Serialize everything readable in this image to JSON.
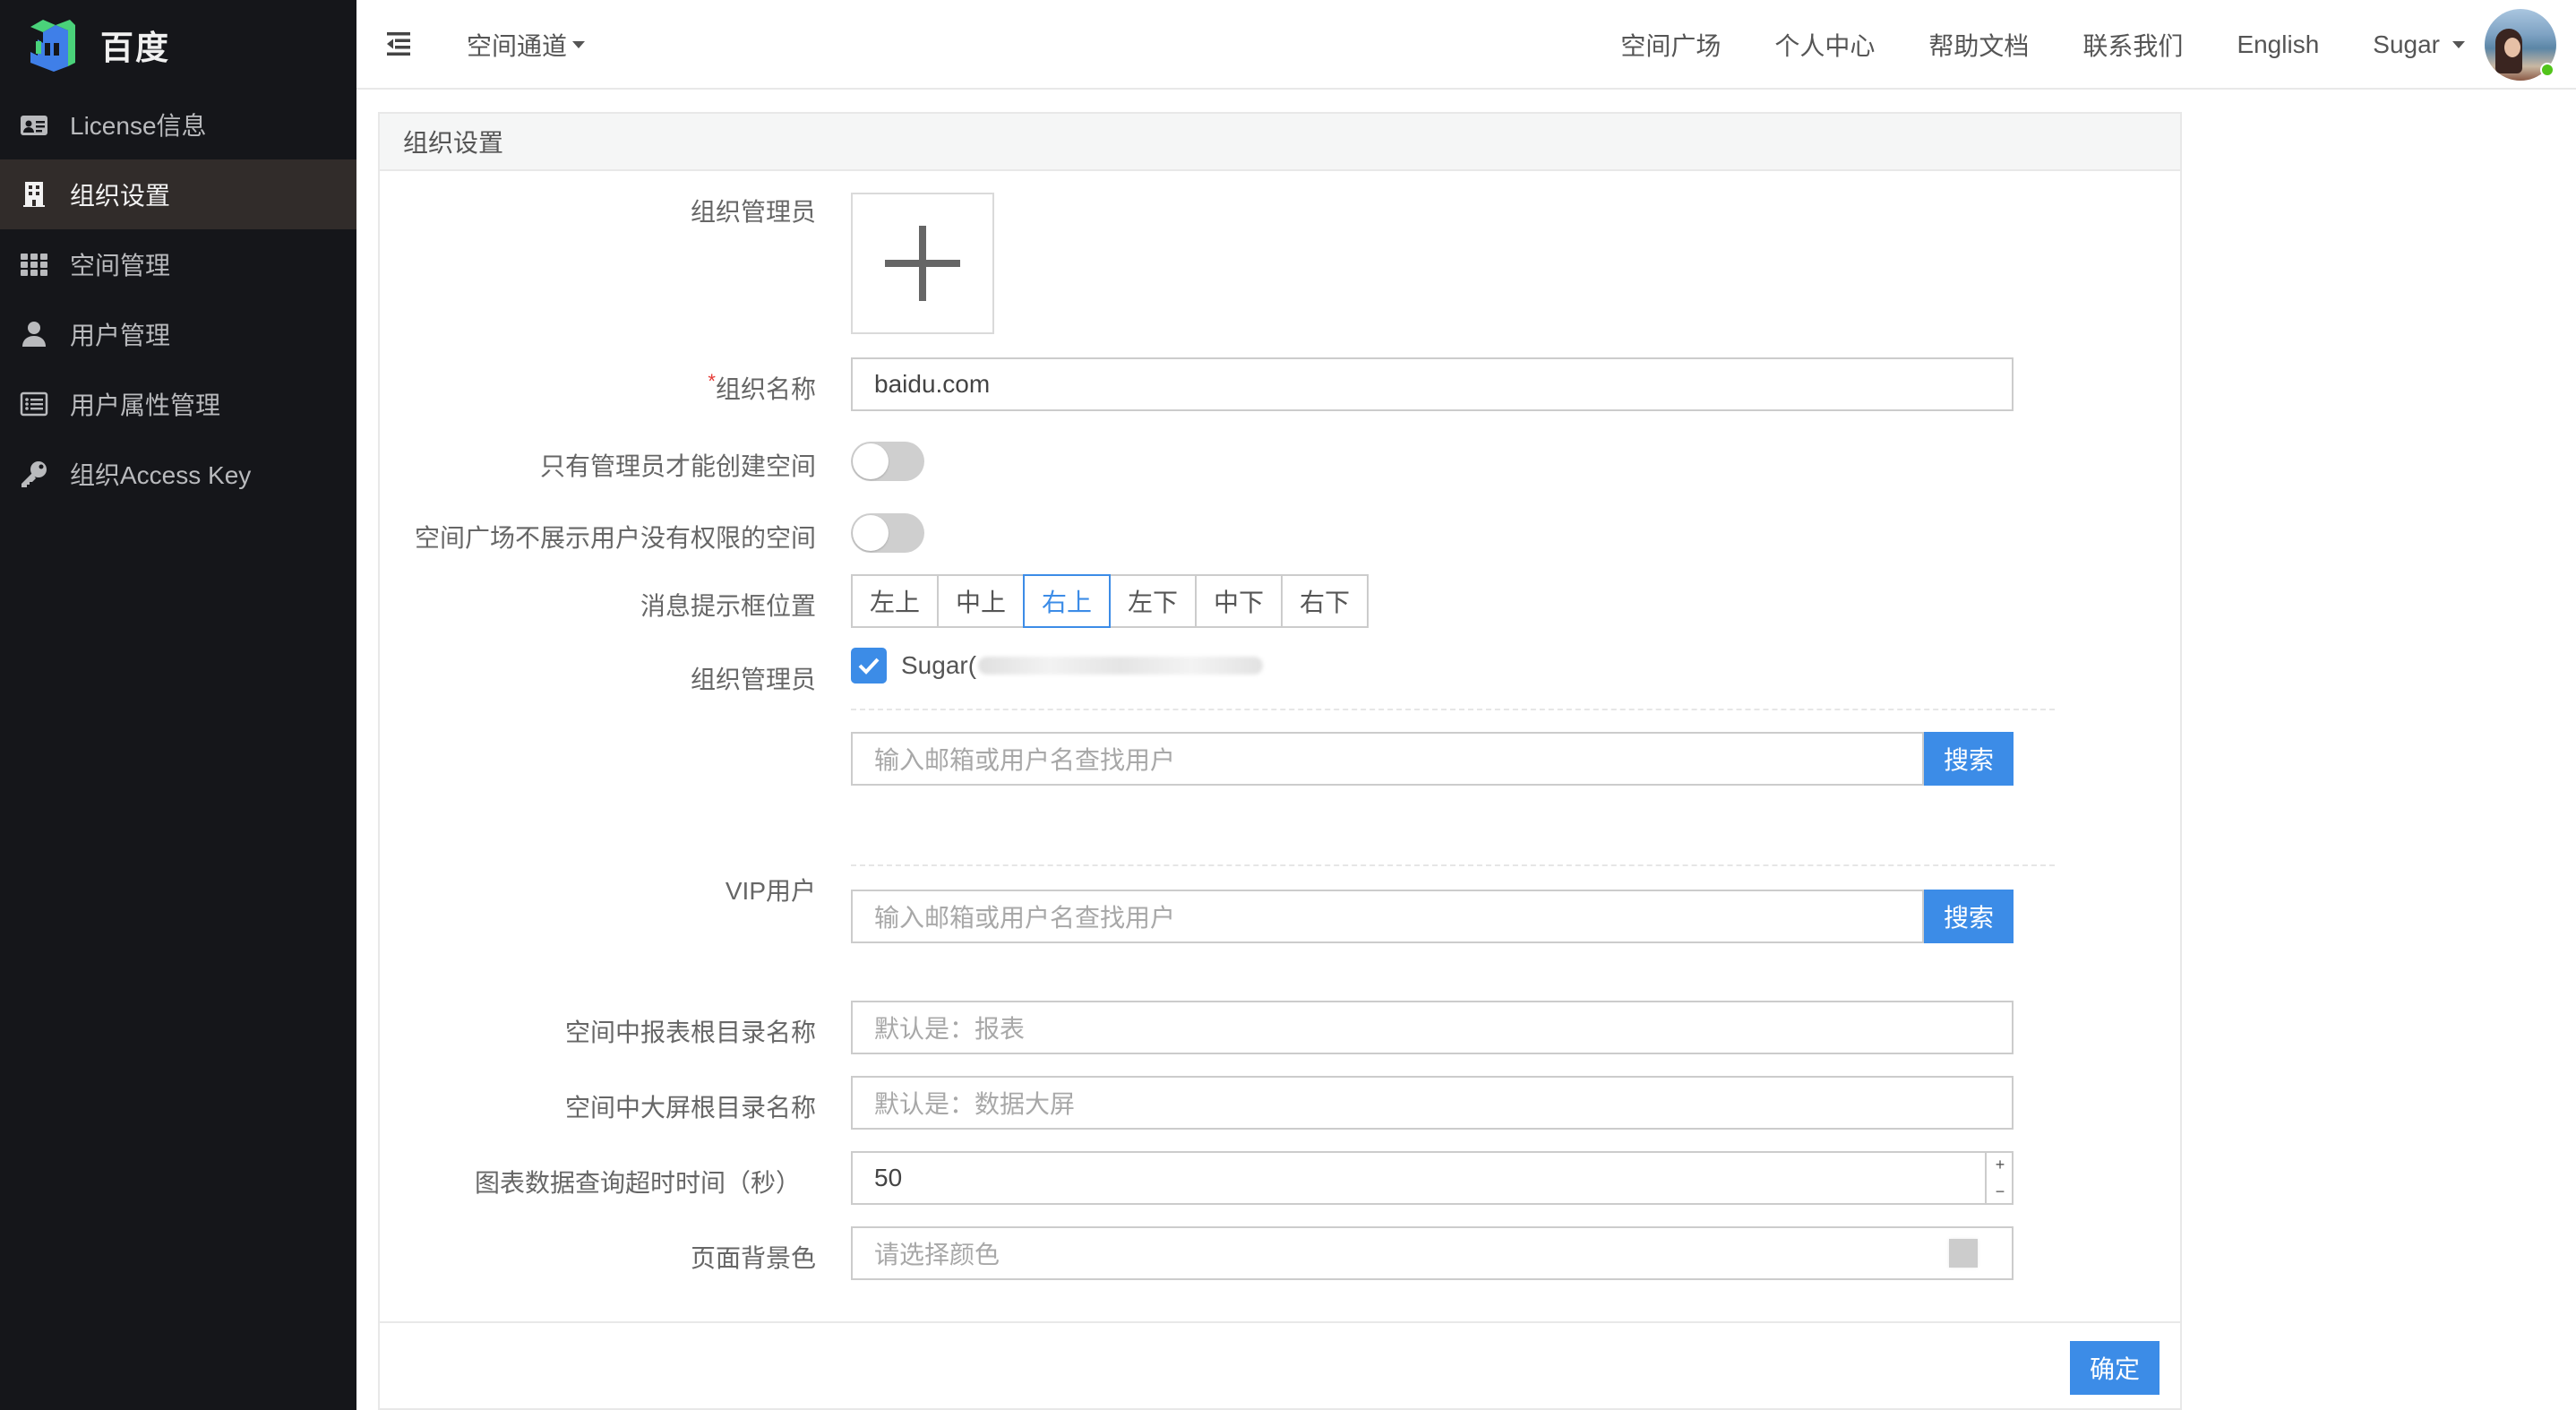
{
  "sidebar": {
    "logo_text": "百度",
    "items": [
      {
        "label": "License信息",
        "icon": "id-card-icon",
        "active": false
      },
      {
        "label": "组织设置",
        "icon": "building-icon",
        "active": true
      },
      {
        "label": "空间管理",
        "icon": "grid-icon",
        "active": false
      },
      {
        "label": "用户管理",
        "icon": "user-icon",
        "active": false
      },
      {
        "label": "用户属性管理",
        "icon": "list-icon",
        "active": false
      },
      {
        "label": "组织Access Key",
        "icon": "key-icon",
        "active": false
      }
    ]
  },
  "header": {
    "channel_label": "空间通道",
    "nav": [
      "空间广场",
      "个人中心",
      "帮助文档",
      "联系我们",
      "English"
    ],
    "user_name": "Sugar"
  },
  "panel": {
    "title": "组织设置",
    "fields": {
      "org_admin_upload_label": "组织管理员",
      "org_name_label": "组织名称",
      "org_name_required_mark": "*",
      "org_name_value": "baidu.com",
      "admin_only_create_label": "只有管理员才能创建空间",
      "admin_only_create_on": false,
      "hide_unauthorized_label": "空间广场不展示用户没有权限的空间",
      "hide_unauthorized_on": false,
      "msg_position_label": "消息提示框位置",
      "msg_positions": [
        "左上",
        "中上",
        "右上",
        "左下",
        "中下",
        "右下"
      ],
      "msg_position_selected": "右上",
      "org_admins_label": "组织管理员",
      "org_admin_checked_name": "Sugar(",
      "admin_search_placeholder": "输入邮箱或用户名查找用户",
      "admin_search_button": "搜索",
      "vip_label": "VIP用户",
      "vip_search_placeholder": "输入邮箱或用户名查找用户",
      "vip_search_button": "搜索",
      "report_root_label": "空间中报表根目录名称",
      "report_root_placeholder": "默认是：报表",
      "screen_root_label": "空间中大屏根目录名称",
      "screen_root_placeholder": "默认是：数据大屏",
      "timeout_label": "图表数据查询超时时间（秒）",
      "timeout_value": "50",
      "stepper_plus": "+",
      "stepper_minus": "−",
      "bg_color_label": "页面背景色",
      "bg_color_placeholder": "请选择颜色",
      "bg_color_swatch": "#cccccc"
    },
    "confirm_button": "确定"
  },
  "colors": {
    "accent": "#3c8ce7",
    "sidebar_bg": "#15161a",
    "sidebar_active_bg": "#312c2a",
    "required": "#e53935",
    "online_dot": "#52c41a"
  }
}
